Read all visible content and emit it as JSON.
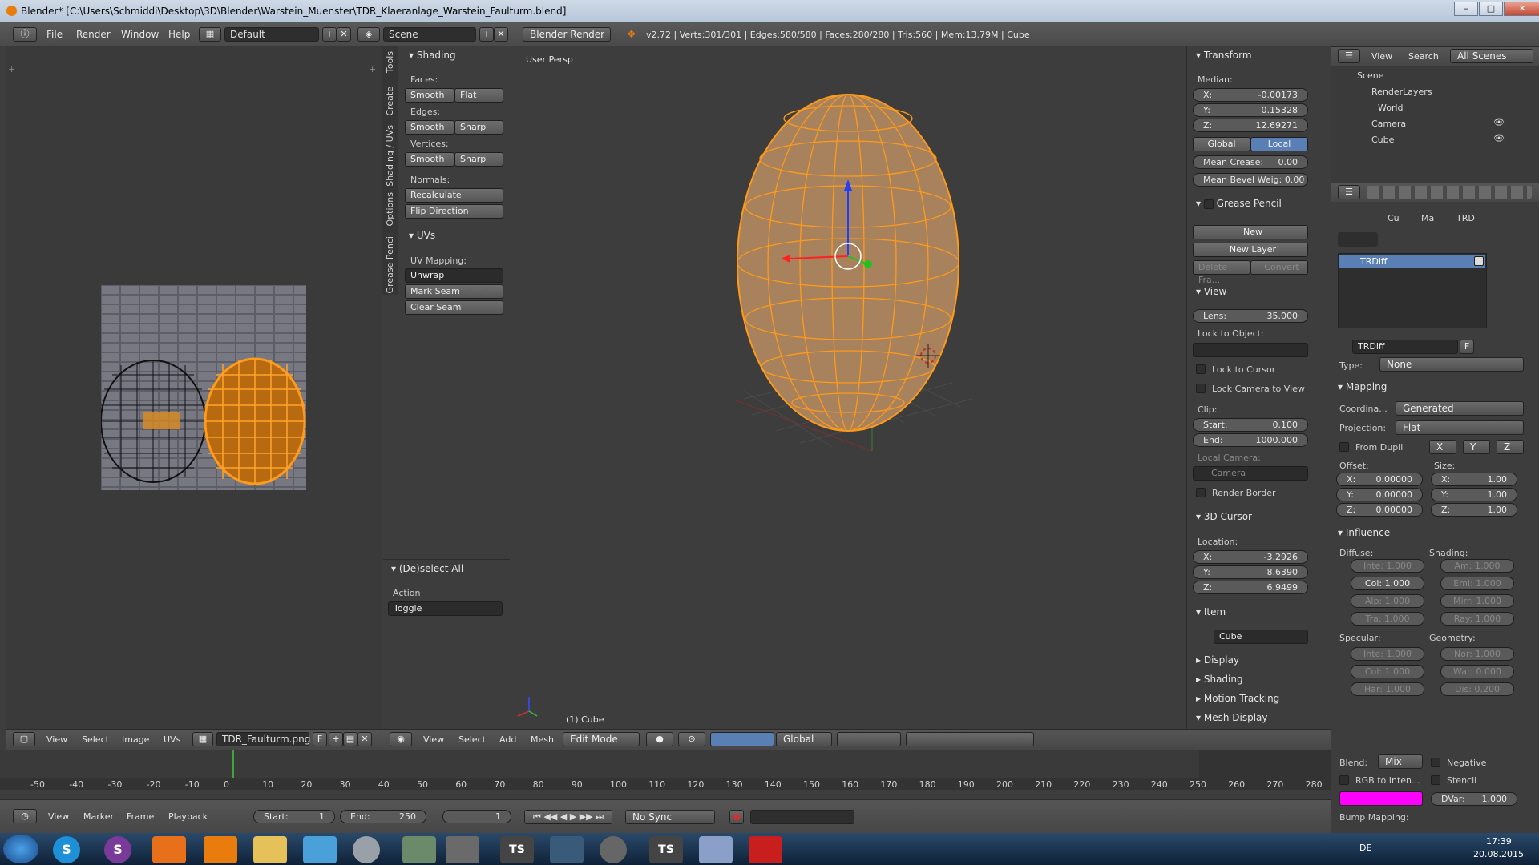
{
  "window": {
    "title": "Blender* [C:\\Users\\Schmiddi\\Desktop\\3D\\Blender\\Warstein_Muenster\\TDR_Klaeranlage_Warstein_Faulturm.blend]"
  },
  "topbar": {
    "menus": [
      "File",
      "Render",
      "Window",
      "Help"
    ],
    "layout": "Default",
    "scene": "Scene",
    "engine": "Blender Render",
    "stats": "v2.72 | Verts:301/301 | Edges:580/580 | Faces:280/280 | Tris:560 | Mem:13.79M | Cube"
  },
  "toolshelf": {
    "tabs": [
      "Tools",
      "Create",
      "Shading / UVs",
      "Options",
      "Grease Pencil"
    ],
    "shading_header": "Shading",
    "faces_label": "Faces:",
    "edges_label": "Edges:",
    "vertices_label": "Vertices:",
    "smooth": "Smooth",
    "flat": "Flat",
    "sharp": "Sharp",
    "normals_label": "Normals:",
    "recalculate": "Recalculate",
    "flip_direction": "Flip Direction",
    "uvs_header": "UVs",
    "uv_mapping_label": "UV Mapping:",
    "unwrap": "Unwrap",
    "mark_seam": "Mark Seam",
    "clear_seam": "Clear Seam",
    "deselect_header": "(De)select All",
    "action_label": "Action",
    "action_value": "Toggle"
  },
  "viewport": {
    "view_name": "User Persp",
    "object_label": "(1) Cube"
  },
  "npanel": {
    "transform_header": "Transform",
    "median_label": "Median:",
    "x_label": "X:",
    "x_val": "-0.00173",
    "y_label": "Y:",
    "y_val": "0.15328",
    "z_label": "Z:",
    "z_val": "12.69271",
    "global": "Global",
    "local": "Local",
    "mean_crease": "Mean Crease:",
    "mean_crease_val": "0.00",
    "mean_bevel": "Mean Bevel Weig: 0.00",
    "grease_pencil_header": "Grease Pencil",
    "new": "New",
    "new_layer": "New Layer",
    "delete_frame": "Delete Fra...",
    "convert": "Convert",
    "view_header": "View",
    "lens_label": "Lens:",
    "lens_val": "35.000",
    "lock_to_object": "Lock to Object:",
    "lock_to_cursor": "Lock to Cursor",
    "lock_camera_to_view": "Lock Camera to View",
    "clip_label": "Clip:",
    "clip_start_label": "Start:",
    "clip_start_val": "0.100",
    "clip_end_label": "End:",
    "clip_end_val": "1000.000",
    "local_camera_label": "Local Camera:",
    "camera": "Camera",
    "render_border": "Render Border",
    "cursor_header": "3D Cursor",
    "location_label": "Location:",
    "cx_val": "-3.2926",
    "cy_val": "8.6390",
    "cz_val": "6.9499",
    "item_header": "Item",
    "item_name": "Cube",
    "display_header": "Display",
    "shading_header": "Shading",
    "motion_tracking_header": "Motion Tracking",
    "mesh_display_header": "Mesh Display"
  },
  "outliner": {
    "view": "View",
    "search": "Search",
    "filter": "All Scenes",
    "items": [
      "Scene",
      "RenderLayers",
      "World",
      "Camera",
      "Cube"
    ]
  },
  "props": {
    "crumbs": [
      "Cu",
      "Ma",
      "TRD"
    ],
    "slot_name": "TRDiff",
    "texture_name": "TRDiff",
    "f_label": "F",
    "type_label": "Type:",
    "type_value": "None",
    "mapping_header": "Mapping",
    "coordinates_label": "Coordina...",
    "coordinates_value": "Generated",
    "projection_label": "Projection:",
    "projection_value": "Flat",
    "from_dupli": "From Dupli",
    "axis_x": "X",
    "axis_y": "Y",
    "axis_z": "Z",
    "offset_label": "Offset:",
    "size_label": "Size:",
    "offset_x": "0.00000",
    "offset_y": "0.00000",
    "offset_z": "0.00000",
    "size_x": "1.00",
    "size_y": "1.00",
    "size_z": "1.00",
    "influence_header": "Influence",
    "diffuse_label": "Diffuse:",
    "shading_label": "Shading:",
    "inte": "Inte: 1.000",
    "col": "Col: 1.000",
    "alp": "Alp: 1.000",
    "tra": "Tra: 1.000",
    "amb": "Am: 1.000",
    "emi": "Emi: 1.000",
    "mir": "Mirr: 1.000",
    "ray": "Ray: 1.000",
    "specular_label": "Specular:",
    "geometry_label": "Geometry:",
    "s_inte": "Inte: 1.000",
    "s_col": "Col: 1.000",
    "s_har": "Har: 1.000",
    "nor": "Nor: 1.000",
    "war": "War: 0.000",
    "dis": "Dis: 0.200",
    "blend_label": "Blend:",
    "blend_value": "Mix",
    "negative": "Negative",
    "rgb_to_intensity": "RGB to Inten...",
    "stencil": "Stencil",
    "dvar": "DVar:",
    "dvar_val": "1.000",
    "bump_mapping": "Bump Mapping:",
    "pink": "#ff00ff"
  },
  "imgeditor_header": {
    "menus": [
      "View",
      "Select",
      "Image",
      "UVs"
    ],
    "image_name": "TDR_Faulturm.png",
    "f": "F"
  },
  "viewport_header": {
    "menus": [
      "View",
      "Select",
      "Add",
      "Mesh"
    ],
    "mode": "Edit Mode",
    "orientation": "Global"
  },
  "timeline": {
    "ticks": [
      "-50",
      "-40",
      "-30",
      "-20",
      "-10",
      "0",
      "10",
      "20",
      "30",
      "40",
      "50",
      "60",
      "70",
      "80",
      "90",
      "100",
      "110",
      "120",
      "130",
      "140",
      "150",
      "160",
      "170",
      "180",
      "190",
      "200",
      "210",
      "220",
      "230",
      "240",
      "250",
      "260",
      "270",
      "280"
    ],
    "menus": [
      "View",
      "Marker",
      "Frame",
      "Playback"
    ],
    "start_label": "Start:",
    "start_val": "1",
    "end_label": "End:",
    "end_val": "250",
    "current": "1",
    "sync": "No Sync"
  },
  "taskbar": {
    "lang": "DE",
    "time": "17:39",
    "date": "20.08.2015",
    "apps": [
      "S",
      "S",
      "",
      "",
      "",
      "",
      "",
      "",
      "TS",
      "",
      "",
      "TS",
      "",
      ""
    ]
  }
}
